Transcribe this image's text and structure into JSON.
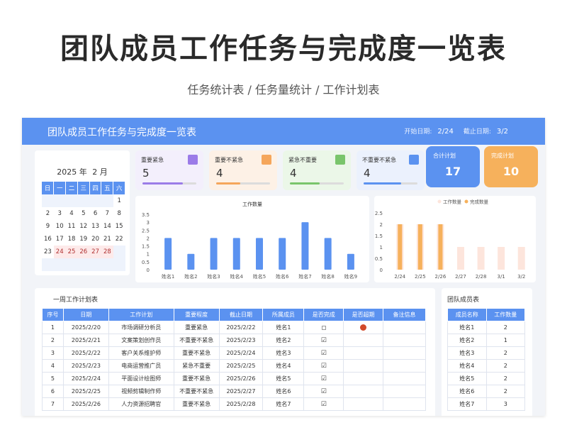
{
  "hero": {
    "title": "团队成员工作任务与完成度一览表",
    "subtitle": "任务统计表 / 任务量统计 / 工作计划表"
  },
  "header": {
    "title": "团队成员工作任务与完成度一览表",
    "start_label": "开始日期:",
    "start_value": "2/24",
    "end_label": "截止日期:",
    "end_value": "3/2"
  },
  "calendar": {
    "year": "2025",
    "year_suffix": "年",
    "month": "2",
    "month_suffix": "月",
    "weekdays": [
      "日",
      "一",
      "二",
      "三",
      "四",
      "五",
      "六"
    ],
    "rows": [
      [
        "",
        "",
        "",
        "",
        "",
        "",
        "1"
      ],
      [
        "2",
        "3",
        "4",
        "5",
        "6",
        "7",
        "8"
      ],
      [
        "9",
        "10",
        "11",
        "12",
        "13",
        "14",
        "15"
      ],
      [
        "16",
        "17",
        "18",
        "19",
        "20",
        "21",
        "22"
      ],
      [
        "23",
        "24",
        "25",
        "26",
        "27",
        "28",
        ""
      ],
      [
        "",
        "",
        "",
        "",
        "",
        "",
        ""
      ]
    ],
    "highlighted": [
      "24",
      "25",
      "26",
      "27",
      "28"
    ]
  },
  "kpis": [
    {
      "label": "重要紧急",
      "value": "5",
      "color": "#9b7be8",
      "fill": 0.75,
      "bg": "#f3effc"
    },
    {
      "label": "重要不紧急",
      "value": "4",
      "color": "#f5a65b",
      "fill": 0.45,
      "bg": "#fdf1e6"
    },
    {
      "label": "紧急不重要",
      "value": "4",
      "color": "#79c56b",
      "fill": 0.55,
      "bg": "#ebf7e8"
    },
    {
      "label": "不重要不紧急",
      "value": "4",
      "color": "#5b92f0",
      "fill": 0.7,
      "bg": "#ebf1fd"
    }
  ],
  "totals": [
    {
      "label": "合计计划",
      "value": "17",
      "color": "#5b92f0"
    },
    {
      "label": "完成计划",
      "value": "10",
      "color": "#f6b15c"
    }
  ],
  "chart_data": [
    {
      "type": "bar",
      "title": "工作数量",
      "categories": [
        "姓名1",
        "姓名2",
        "姓名3",
        "姓名4",
        "姓名5",
        "姓名6",
        "姓名7",
        "姓名8",
        "姓名9"
      ],
      "values": [
        2,
        1,
        2,
        2,
        2,
        2,
        3,
        2,
        1
      ],
      "ylim": [
        0,
        3.5
      ],
      "yticks": [
        "0",
        "0.5",
        "1",
        "1.5",
        "2",
        "2.5",
        "3",
        "3.5"
      ],
      "color": "#5b92f0",
      "grid": false
    },
    {
      "type": "bar",
      "title": "",
      "legend": [
        "工作数量",
        "完成数量"
      ],
      "categories": [
        "2/24",
        "2/25",
        "2/26",
        "2/27",
        "2/28",
        "3/1",
        "3/2"
      ],
      "series": [
        {
          "name": "工作数量",
          "values": [
            2,
            2,
            2,
            1,
            1,
            1,
            1
          ],
          "color": "#fde5dc"
        },
        {
          "name": "完成数量",
          "values": [
            2,
            2,
            2,
            0,
            0,
            0,
            0
          ],
          "color": "#f6b15c"
        }
      ],
      "ylim": [
        0,
        2.5
      ],
      "yticks": [
        "0",
        "0.5",
        "1",
        "1.5",
        "2",
        "2.5"
      ],
      "legend_position": "top-right",
      "grid": false
    }
  ],
  "plan": {
    "title": "一周工作计划表",
    "headers": [
      "序号",
      "日期",
      "工作计划",
      "重要程度",
      "截止日期",
      "所属成员",
      "是否完成",
      "是否超期",
      "备注信息"
    ],
    "rows": [
      [
        "1",
        "2025/2/20",
        "市场调研分析员",
        "重要紧急",
        "2025/2/22",
        "姓名1",
        "box",
        "dot",
        ""
      ],
      [
        "2",
        "2025/2/21",
        "文案策划创作员",
        "不重要不紧急",
        "2025/2/23",
        "姓名2",
        "check",
        "",
        ""
      ],
      [
        "3",
        "2025/2/22",
        "客户关系维护师",
        "重要不紧急",
        "2025/2/24",
        "姓名3",
        "check",
        "",
        ""
      ],
      [
        "4",
        "2025/2/23",
        "电商运营推广员",
        "紧急不重要",
        "2025/2/25",
        "姓名4",
        "check",
        "",
        ""
      ],
      [
        "5",
        "2025/2/24",
        "平面设计绘图师",
        "重要不紧急",
        "2025/2/26",
        "姓名5",
        "check",
        "",
        ""
      ],
      [
        "6",
        "2025/2/25",
        "视频剪辑制作师",
        "不重要不紧急",
        "2025/2/27",
        "姓名6",
        "check",
        "",
        ""
      ],
      [
        "7",
        "2025/2/26",
        "人力资源招聘官",
        "重要不紧急",
        "2025/2/28",
        "姓名7",
        "check",
        "",
        ""
      ]
    ]
  },
  "members": {
    "title": "团队成员表",
    "headers": [
      "成员名称",
      "工作数量"
    ],
    "rows": [
      [
        "姓名1",
        "2"
      ],
      [
        "姓名2",
        "1"
      ],
      [
        "姓名3",
        "2"
      ],
      [
        "姓名4",
        "2"
      ],
      [
        "姓名5",
        "2"
      ],
      [
        "姓名6",
        "2"
      ],
      [
        "姓名7",
        "3"
      ]
    ]
  }
}
